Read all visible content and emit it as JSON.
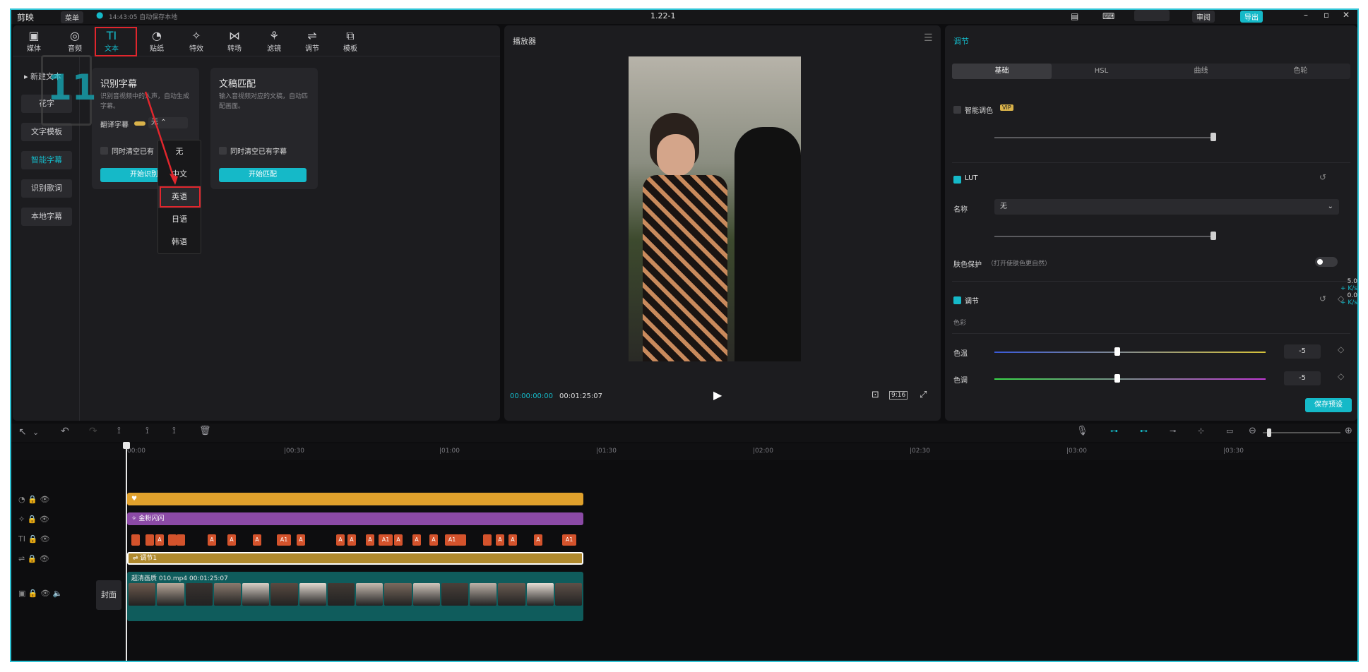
{
  "window": {
    "app_title": "剪映",
    "menu": "菜单",
    "autosave": "14:43:05 自动保存本地",
    "project_name": "1.22-1",
    "share_button": "审阅",
    "export_button": "导出"
  },
  "toolbar": {
    "items": [
      {
        "label": "媒体"
      },
      {
        "label": "音频"
      },
      {
        "label": "文本"
      },
      {
        "label": "贴纸"
      },
      {
        "label": "特效"
      },
      {
        "label": "转场"
      },
      {
        "label": "滤镜"
      },
      {
        "label": "调节"
      },
      {
        "label": "模板"
      }
    ]
  },
  "sidebar": {
    "items": [
      {
        "label": "新建文本"
      },
      {
        "label": "花字"
      },
      {
        "label": "文字模板"
      },
      {
        "label": "智能字幕"
      },
      {
        "label": "识别歌词"
      },
      {
        "label": "本地字幕"
      }
    ]
  },
  "cards": {
    "recognize": {
      "title": "识别字幕",
      "desc": "识别音视频中的人声，自动生成字幕。",
      "translate_label": "翻译字幕",
      "translate_value": "无",
      "clear_label": "同时清空已有",
      "start_button": "开始识别"
    },
    "match": {
      "title": "文稿匹配",
      "desc": "输入音视频对应的文稿，自动匹配画面。",
      "clear_label": "同时清空已有字幕",
      "start_button": "开始匹配"
    }
  },
  "language_dropdown": {
    "options": [
      "无",
      "中文",
      "英语",
      "日语",
      "韩语"
    ],
    "highlighted": "英语"
  },
  "player": {
    "title": "播放器",
    "current_time": "00:00:00:00",
    "total_time": "00:01:25:07",
    "ratio": "9:16"
  },
  "adjust_panel": {
    "title": "调节",
    "tabs": [
      "基础",
      "HSL",
      "曲线",
      "色轮"
    ],
    "smart_color": {
      "label": "智能调色",
      "badge": "VIP"
    },
    "lut": {
      "label": "LUT",
      "name_label": "名称",
      "name_value": "无",
      "skin_label": "肤色保护",
      "skin_hint": "（打开使肤色更自然）"
    },
    "adjust": {
      "label": "调节",
      "sub_label": "色彩",
      "temp_label": "色温",
      "temp_value": "-5",
      "tint_label": "色调",
      "tint_value": "-5"
    },
    "save_button": "保存预设",
    "side_values": [
      "5.0",
      "+ K/s",
      "0.0",
      "+ K/s"
    ]
  },
  "timeline": {
    "ruler": [
      "00:00",
      "|00:30",
      "|01:00",
      "|01:30",
      "|02:00",
      "|02:30",
      "|03:00",
      "|03:30"
    ],
    "sticker_track": {
      "label": ""
    },
    "effect_track": {
      "label": "金粉闪闪"
    },
    "adjust_track": {
      "label": "调节1"
    },
    "video_track": {
      "label": "超清画质  010.mp4  00:01:25:07"
    },
    "cover_label": "封面",
    "text_chips": [
      "",
      "",
      "A",
      "",
      "",
      "A",
      "A",
      "A",
      "A1",
      "A",
      "A",
      "A",
      "A",
      "A1",
      "A",
      "A",
      "A",
      "A1",
      "",
      "",
      "A",
      "A",
      "A",
      "A1"
    ]
  },
  "watermark": {
    "text": "11"
  },
  "colors": {
    "accent": "#15b9c8",
    "frame": "#2fc4d6",
    "highlight": "#e0262d"
  }
}
